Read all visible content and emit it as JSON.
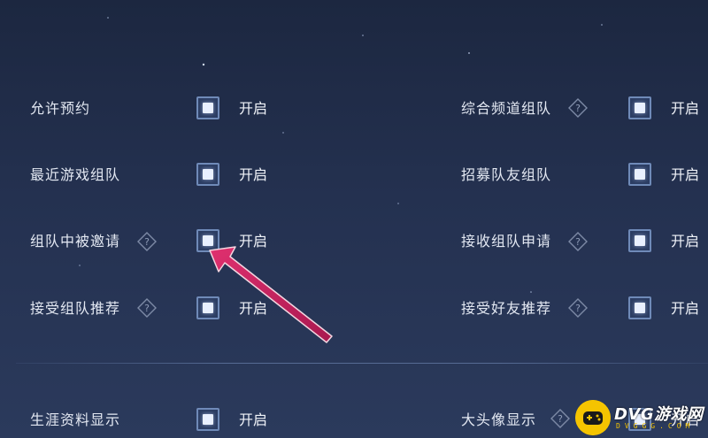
{
  "settings": {
    "left": [
      {
        "label": "允许预约",
        "help": false,
        "value": "开启"
      },
      {
        "label": "最近游戏组队",
        "help": false,
        "value": "开启"
      },
      {
        "label": "组队中被邀请",
        "help": true,
        "value": "开启"
      },
      {
        "label": "接受组队推荐",
        "help": true,
        "value": "开启"
      },
      {
        "label": "生涯资料显示",
        "help": false,
        "value": "开启"
      }
    ],
    "right": [
      {
        "label": "综合频道组队",
        "help": true,
        "value": "开启"
      },
      {
        "label": "招募队友组队",
        "help": false,
        "value": "开启"
      },
      {
        "label": "接收组队申请",
        "help": true,
        "value": "开启"
      },
      {
        "label": "接受好友推荐",
        "help": true,
        "value": "开启"
      },
      {
        "label": "大头像显示",
        "help": true,
        "value": "开启"
      }
    ]
  },
  "watermark": {
    "text": "DVG游戏网",
    "sub": "DVGGG.COM"
  },
  "colors": {
    "arrow": "#c3205f",
    "checkbox_border": "#6f8ab8",
    "logo_yellow": "#f5c400"
  },
  "icons": {
    "help": "question-diamond-icon",
    "arrow": "pointer-arrow-icon",
    "logo": "gamepad-icon"
  }
}
